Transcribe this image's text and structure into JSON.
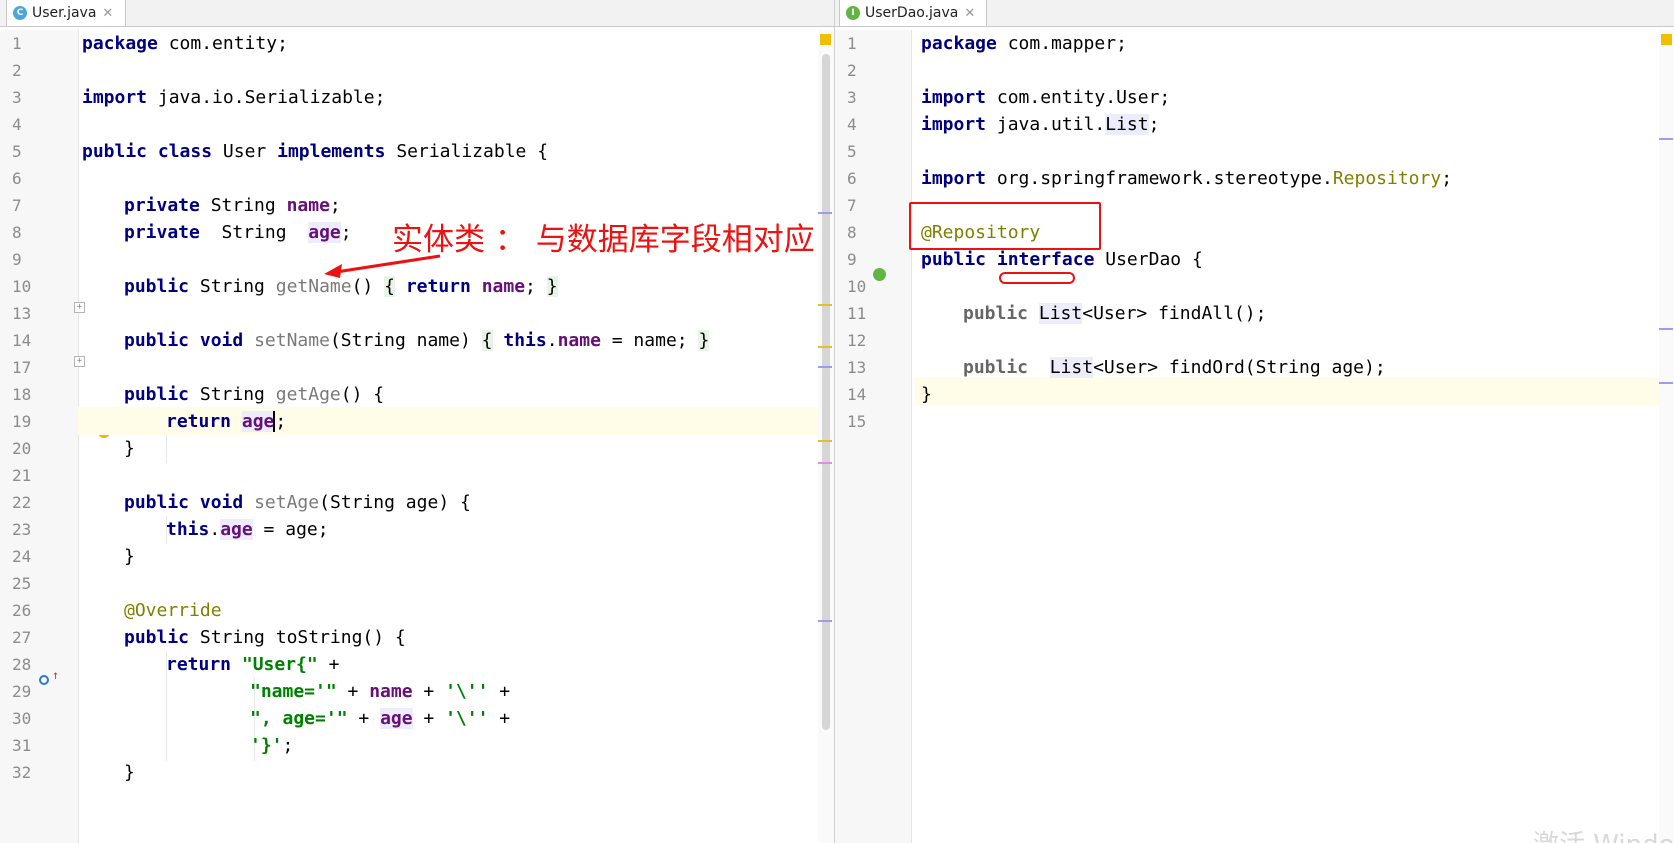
{
  "left": {
    "tab": {
      "label": "User.java",
      "icon": "C",
      "icon_color": "#4aa7dc"
    },
    "annotation_text": "实体类 ： 与数据库字段相对应",
    "lines": [
      {
        "n": "1"
      },
      {
        "n": "2"
      },
      {
        "n": "3"
      },
      {
        "n": "4"
      },
      {
        "n": "5"
      },
      {
        "n": "6"
      },
      {
        "n": "7"
      },
      {
        "n": "8"
      },
      {
        "n": "9"
      },
      {
        "n": "10"
      },
      {
        "n": "13"
      },
      {
        "n": "14"
      },
      {
        "n": "17"
      },
      {
        "n": "18"
      },
      {
        "n": "19"
      },
      {
        "n": "20"
      },
      {
        "n": "21"
      },
      {
        "n": "22"
      },
      {
        "n": "23"
      },
      {
        "n": "24"
      },
      {
        "n": "25"
      },
      {
        "n": "26"
      },
      {
        "n": "27"
      },
      {
        "n": "28"
      },
      {
        "n": "29"
      },
      {
        "n": "30"
      },
      {
        "n": "31"
      },
      {
        "n": "32"
      }
    ]
  },
  "right": {
    "tab": {
      "label": "UserDao.java",
      "icon": "I",
      "icon_color": "#62b543"
    },
    "lines": [
      {
        "n": "1"
      },
      {
        "n": "2"
      },
      {
        "n": "3"
      },
      {
        "n": "4"
      },
      {
        "n": "5"
      },
      {
        "n": "6"
      },
      {
        "n": "7"
      },
      {
        "n": "8"
      },
      {
        "n": "9"
      },
      {
        "n": "10"
      },
      {
        "n": "11"
      },
      {
        "n": "12"
      },
      {
        "n": "13"
      },
      {
        "n": "14"
      },
      {
        "n": "15"
      }
    ]
  },
  "code": {
    "L1": [
      "package",
      " com.entity;"
    ],
    "L3": [
      "import",
      " java.io.Serializable;"
    ],
    "L5": [
      "public",
      "class",
      "User",
      "implements",
      " Serializable {"
    ],
    "L7": [
      "private",
      " String ",
      "name",
      ";"
    ],
    "L8": [
      "private",
      "  String  ",
      "age",
      ";"
    ],
    "L10": [
      "public",
      " String ",
      "getName",
      "()",
      "{",
      "return",
      "name",
      ";",
      "}"
    ],
    "L14": [
      "public",
      "void",
      "setName",
      "(String name)",
      "{",
      "this",
      ".",
      "name",
      " = name;",
      "}"
    ],
    "L18": [
      "public",
      " String ",
      "getAge",
      "() {"
    ],
    "L19": [
      "return",
      "age",
      ";"
    ],
    "L20": [
      "}"
    ],
    "L22": [
      "public",
      "void",
      "setAge",
      "(String age) {"
    ],
    "L23": [
      "this",
      ".",
      "age",
      " = age;"
    ],
    "L24": [
      "}"
    ],
    "L26": [
      "@Override"
    ],
    "L27": [
      "public",
      " String toString() {"
    ],
    "L28": [
      "return",
      "\"User{\"",
      " +"
    ],
    "L29": [
      "\"name='\"",
      " + ",
      "name",
      " + ",
      "'\\''",
      " +"
    ],
    "L30": [
      "\", age='\"",
      " + ",
      "age",
      " + ",
      "'\\''",
      " +"
    ],
    "L31": [
      "'}'",
      ";"
    ],
    "L32": [
      "}"
    ],
    "R1": [
      "package",
      " com.mapper;"
    ],
    "R3": [
      "import",
      " com.entity.User;"
    ],
    "R4": [
      "import",
      " java.util.",
      "List",
      ";"
    ],
    "R6": [
      "import",
      " org.springframework.stereotype.",
      "Repository",
      ";"
    ],
    "R8": [
      "@Repository"
    ],
    "R9": [
      "public",
      "interface",
      " UserDao {"
    ],
    "R11": [
      "public",
      "List",
      "<User> findAll();"
    ],
    "R13": [
      "public",
      "List",
      "<User> findOrd(String age);"
    ],
    "R14": [
      "}"
    ]
  },
  "watermark": "激活 Windows",
  "colors": {
    "keyword": "#000080",
    "field": "#660e7a",
    "string": "#008000",
    "annotation": "#808000",
    "red_markup": "#ee1111"
  }
}
